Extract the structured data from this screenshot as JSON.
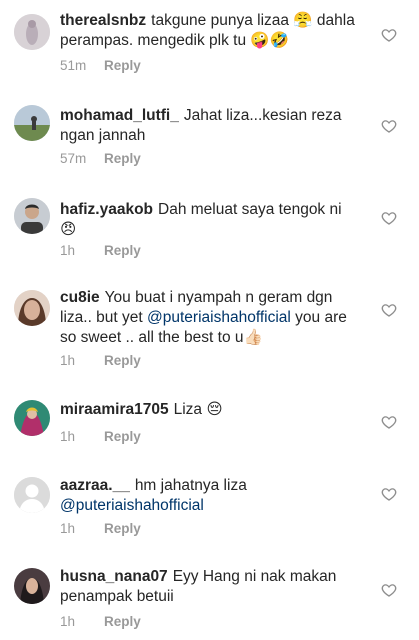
{
  "comments": [
    {
      "username": "therealsnbz",
      "text": "takgune punya lizaa 😤 dahla perampas. mengedik plk tu 🤪🤣",
      "time": "51m",
      "reply": "Reply",
      "avatar_color": "#c9c2c8"
    },
    {
      "username": "mohamad_lutfi_",
      "text": "Jahat liza...kesian reza ngan jannah",
      "time": "57m",
      "reply": "Reply",
      "avatar_color": "#7f9a6c"
    },
    {
      "username": "hafiz.yaakob",
      "text": "Dah meluat saya tengok ni 😠",
      "time": "1h",
      "reply": "Reply",
      "avatar_color": "#9aa3ad"
    },
    {
      "username": "cu8ie",
      "text_before": "You buat i nyampah n geram dgn liza.. but yet ",
      "mention": "@puteriaishahofficial",
      "text_after": " you are so sweet .. all the best to u👍🏻",
      "time": "1h",
      "reply": "Reply",
      "avatar_color": "#c6a28b"
    },
    {
      "username": "miraamira1705",
      "text": "Liza 😔",
      "time": "1h",
      "reply": "Reply",
      "avatar_color": "#5b3b6e"
    },
    {
      "username": "aazraa.__",
      "text_before": "hm jahatnya liza ",
      "mention": "@puteriaishahofficial",
      "time": "1h",
      "reply": "Reply",
      "avatar_color": "#dbdbdb"
    },
    {
      "username": "husna_nana07",
      "text": "Eyy Hang ni nak makan penampak betuii",
      "time": "1h",
      "reply": "Reply",
      "avatar_color": "#3a2f33"
    }
  ]
}
